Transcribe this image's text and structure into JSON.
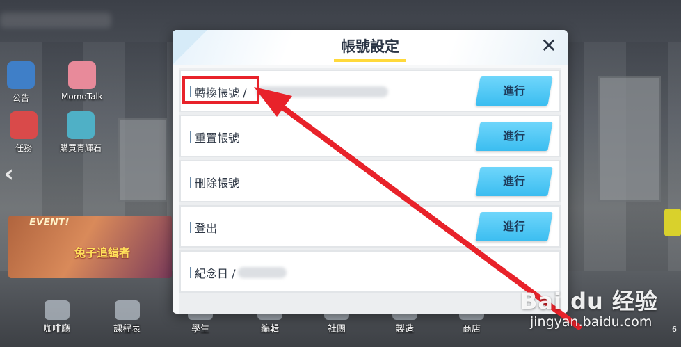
{
  "dialog": {
    "title": "帳號設定",
    "close_symbol": "✕",
    "rows": [
      {
        "label": "轉換帳號 /",
        "button": "進行"
      },
      {
        "label": "重置帳號",
        "button": "進行"
      },
      {
        "label": "刪除帳號",
        "button": "進行"
      },
      {
        "label": "登出",
        "button": "進行"
      },
      {
        "label": "紀念日 /",
        "button": ""
      }
    ]
  },
  "background": {
    "left_icons": [
      {
        "label": "公告",
        "icon": "megaphone-icon"
      },
      {
        "label": "MomoTalk",
        "icon": "momotalk-icon"
      },
      {
        "label": "任務",
        "icon": "checklist-icon"
      },
      {
        "label": "購買青輝石",
        "icon": "gem-icon"
      }
    ],
    "event_badge": "EVENT!",
    "event_title": "兔子追緝者",
    "bottom_nav": [
      "咖啡廳",
      "課程表",
      "學生",
      "編輯",
      "社團",
      "製造",
      "商店"
    ],
    "right_edge_text": "6"
  },
  "watermark": {
    "logo": "Bai du 经验",
    "url": "jingyan.baidu.com"
  },
  "colors": {
    "button_bg": "#3bbdf0",
    "title_accent": "#ffd93b",
    "annotation_red": "#e8222a"
  }
}
